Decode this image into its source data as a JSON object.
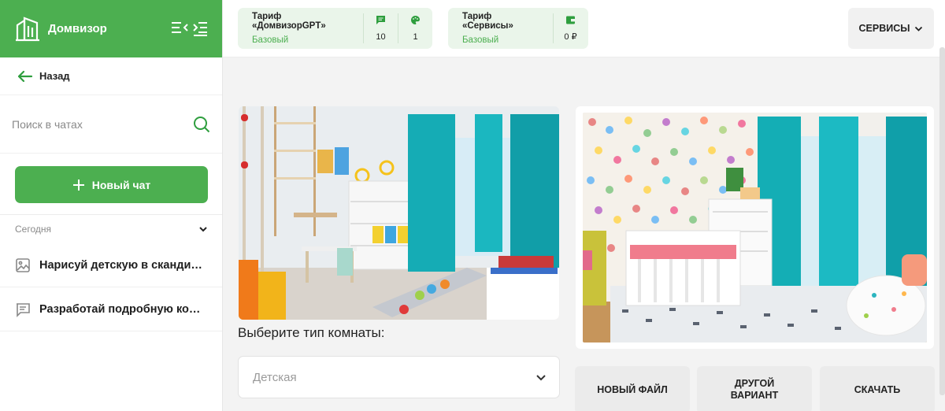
{
  "app": {
    "brand": "Домвизор"
  },
  "sidebar": {
    "back_label": "Назад",
    "search_placeholder": "Поиск в чатах",
    "new_chat_label": "Новый чат",
    "group_label": "Сегодня",
    "chats": [
      {
        "title": "Нарисуй детскую в скандинавском стиле",
        "icon": "image-icon"
      },
      {
        "title": "Разработай подробную концепцию",
        "icon": "chat-icon"
      }
    ]
  },
  "topbar": {
    "tariff_gpt": {
      "title": "Тариф «ДомвизорGPT»",
      "plan": "Базовый",
      "messages": "10",
      "images": "1"
    },
    "tariff_services": {
      "title": "Тариф «Сервисы»",
      "plan": "Базовый",
      "balance": "0 ₽"
    },
    "services_label": "СЕРВИСЫ"
  },
  "main": {
    "prompt_label": "Выберите тип комнаты:",
    "room_select_value": "Детская",
    "actions": {
      "new_file": "НОВЫЙ ФАЙЛ",
      "other_variant": "ДРУГОЙ\nВАРИАНТ",
      "download": "СКАЧАТЬ"
    }
  },
  "colors": {
    "accent": "#4caf50",
    "tariff_bg": "#eaf5ea",
    "curtain": "#14aeb5"
  }
}
